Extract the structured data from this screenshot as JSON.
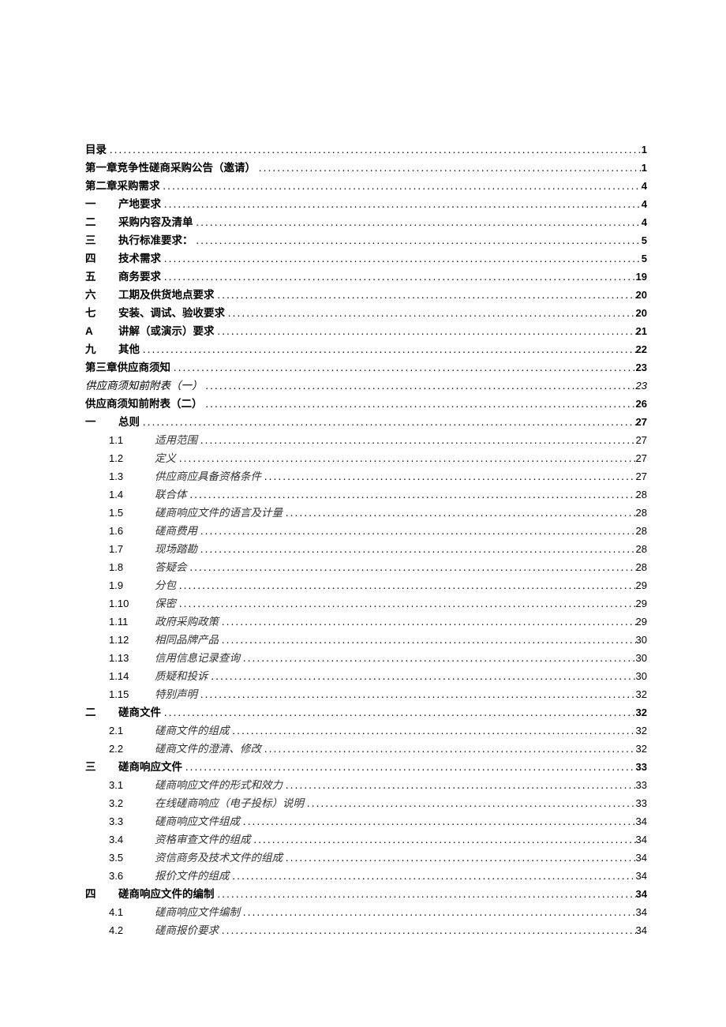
{
  "toc": [
    {
      "level": 0,
      "num": "",
      "title": "目录",
      "page": "1",
      "bold": true,
      "indent": 0
    },
    {
      "level": 0,
      "num": "",
      "title": "第一章竞争性磋商采购公告（邀请）",
      "page": "1",
      "bold": true,
      "indent": 0
    },
    {
      "level": 0,
      "num": "",
      "title": "第二章采购需求",
      "page": "4",
      "bold": true,
      "indent": 0
    },
    {
      "level": 1,
      "num": "一",
      "title": "产地要求",
      "page": "4",
      "bold": true,
      "indent": 1
    },
    {
      "level": 1,
      "num": "二",
      "title": "采购内容及清单",
      "page": "4",
      "bold": true,
      "indent": 1
    },
    {
      "level": 1,
      "num": "三",
      "title": "执行标准要求：",
      "page": "5",
      "bold": true,
      "indent": 1
    },
    {
      "level": 1,
      "num": "四",
      "title": "技术需求",
      "page": "5",
      "bold": true,
      "indent": 1
    },
    {
      "level": 1,
      "num": "五",
      "title": "商务要求",
      "page": "19",
      "bold": true,
      "indent": 1
    },
    {
      "level": 1,
      "num": "六",
      "title": "工期及供货地点要求",
      "page": "20",
      "bold": true,
      "indent": 1
    },
    {
      "level": 1,
      "num": "七",
      "title": "安装、调试、验收要求",
      "page": "20",
      "bold": true,
      "indent": 1
    },
    {
      "level": 1,
      "num": "A",
      "title": "讲解（或演示）要求",
      "page": "21",
      "bold": true,
      "indent": 1,
      "numBold": true
    },
    {
      "level": 1,
      "num": "九",
      "title": "其他",
      "page": "22",
      "bold": true,
      "indent": 1
    },
    {
      "level": 0,
      "num": "",
      "title": "第三章供应商须知",
      "page": "23",
      "bold": true,
      "indent": 0
    },
    {
      "level": 0,
      "num": "",
      "title": "供应商须知前附表（一）",
      "page": "23",
      "bold": false,
      "italic": true,
      "indent": 0,
      "pageItalic": true
    },
    {
      "level": 0,
      "num": "",
      "title": "供应商须知前附表（二）",
      "page": "26",
      "bold": true,
      "indent": 0
    },
    {
      "level": 1,
      "num": "一",
      "title": "总则",
      "page": "27",
      "bold": true,
      "indent": 1
    },
    {
      "level": 2,
      "num": "1.1",
      "title": "适用范围",
      "page": "27",
      "indent": 2
    },
    {
      "level": 2,
      "num": "1.2",
      "title": "定义",
      "page": "27",
      "indent": 2
    },
    {
      "level": 2,
      "num": "1.3",
      "title": "供应商应具备资格条件",
      "page": "27",
      "indent": 2
    },
    {
      "level": 2,
      "num": "1.4",
      "title": "联合体",
      "page": "28",
      "indent": 2
    },
    {
      "level": 2,
      "num": "1.5",
      "title": "磋商响应文件的语言及计量",
      "page": "28",
      "indent": 2
    },
    {
      "level": 2,
      "num": "1.6",
      "title": "磋商费用",
      "page": "28",
      "indent": 2
    },
    {
      "level": 2,
      "num": "1.7",
      "title": "现场踏勘",
      "page": "28",
      "indent": 2
    },
    {
      "level": 2,
      "num": "1.8",
      "title": "答疑会",
      "page": "28",
      "indent": 2
    },
    {
      "level": 2,
      "num": "1.9",
      "title": "分包",
      "page": "29",
      "indent": 2
    },
    {
      "level": 2,
      "num": "1.10",
      "title": "保密",
      "page": "29",
      "indent": 2
    },
    {
      "level": 2,
      "num": "1.11",
      "title": "政府采购政策",
      "page": "29",
      "indent": 2
    },
    {
      "level": 2,
      "num": "1.12",
      "title": "相同品牌产品",
      "page": "30",
      "indent": 2
    },
    {
      "level": 2,
      "num": "1.13",
      "title": "信用信息记录查询",
      "page": "30",
      "indent": 2
    },
    {
      "level": 2,
      "num": "1.14",
      "title": "质疑和投诉",
      "page": "30",
      "indent": 2
    },
    {
      "level": 2,
      "num": "1.15",
      "title": "特别声明",
      "page": "32",
      "indent": 2
    },
    {
      "level": 1,
      "num": "二",
      "title": "磋商文件",
      "page": "32",
      "bold": true,
      "indent": 1
    },
    {
      "level": 2,
      "num": "2.1",
      "title": "磋商文件的组成",
      "page": "32",
      "indent": 2
    },
    {
      "level": 2,
      "num": "2.2",
      "title": "磋商文件的澄清、修改",
      "page": "32",
      "indent": 2
    },
    {
      "level": 1,
      "num": "三",
      "title": "磋商响应文件",
      "page": "33",
      "bold": true,
      "indent": 1
    },
    {
      "level": 2,
      "num": "3.1",
      "title": "磋商响应文件的形式和效力",
      "page": "33",
      "indent": 2
    },
    {
      "level": 2,
      "num": "3.2",
      "title": "在线磋商响应（电子投标）说明",
      "page": "33",
      "indent": 2
    },
    {
      "level": 2,
      "num": "3.3",
      "title": "磋商响应文件组成",
      "page": "34",
      "indent": 2
    },
    {
      "level": 2,
      "num": "3.4",
      "title": "资格审查文件的组成",
      "page": "34",
      "indent": 2
    },
    {
      "level": 2,
      "num": "3.5",
      "title": "资信商务及技术文件的组成",
      "page": "34",
      "indent": 2
    },
    {
      "level": 2,
      "num": "3.6",
      "title": "报价文件的组成",
      "page": "34",
      "indent": 2
    },
    {
      "level": 1,
      "num": "四",
      "title": "磋商响应文件的编制",
      "page": "34",
      "bold": true,
      "indent": 1
    },
    {
      "level": 2,
      "num": "4.1",
      "title": "磋商响应文件编制",
      "page": "34",
      "indent": 2
    },
    {
      "level": 2,
      "num": "4.2",
      "title": "磋商报价要求",
      "page": "34",
      "indent": 2
    }
  ]
}
